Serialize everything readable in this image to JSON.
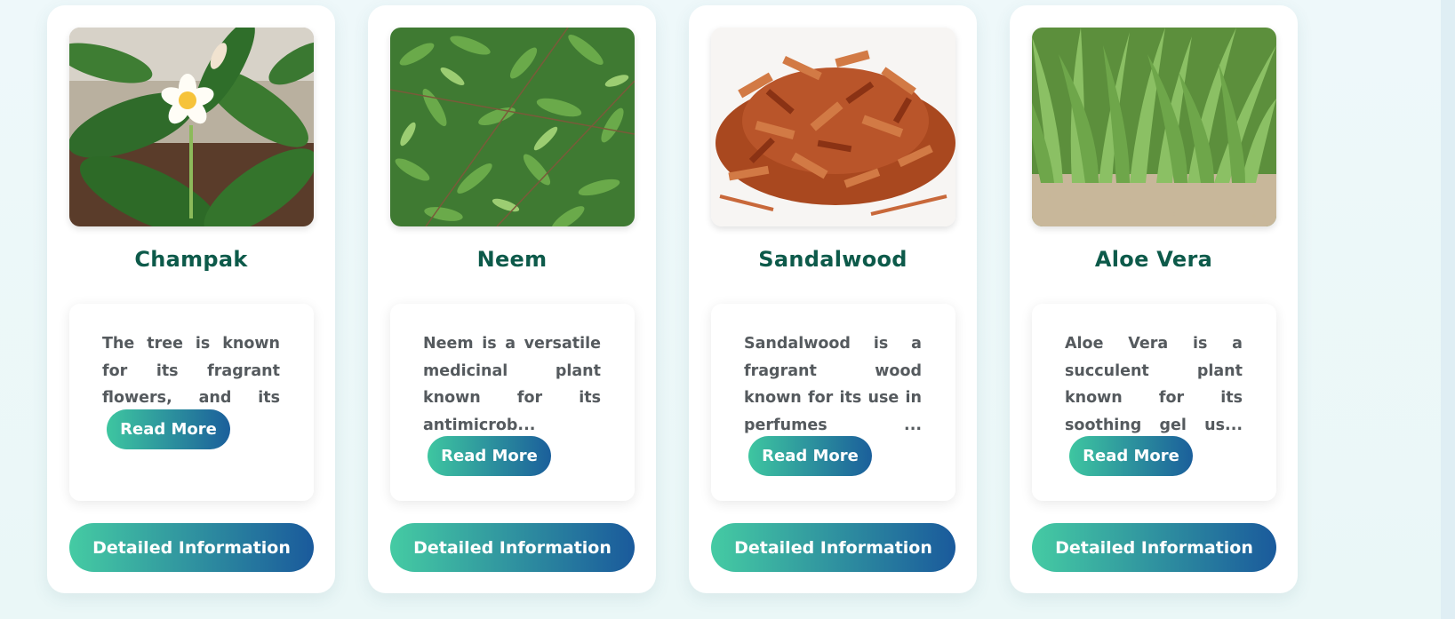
{
  "cards": [
    {
      "title": "Champak",
      "description": "The tree is known for its fragrant flowers, and its timber i...",
      "read_more_label": "Read More",
      "detail_label": "Detailed Information",
      "image_icon": "champak-flower-image"
    },
    {
      "title": "Neem",
      "description": "Neem is a versatile medicinal plant known for its antimicrob...",
      "read_more_label": "Read More",
      "detail_label": "Detailed Information",
      "image_icon": "neem-leaves-image"
    },
    {
      "title": "Sandalwood",
      "description": "Sandalwood is a fragrant wood known for its use in perfumes ...",
      "read_more_label": "Read More",
      "detail_label": "Detailed Information",
      "image_icon": "sandalwood-chips-image"
    },
    {
      "title": "Aloe Vera",
      "description": "Aloe Vera is a succulent plant known for its soothing gel us...",
      "read_more_label": "Read More",
      "detail_label": "Detailed Information",
      "image_icon": "aloe-vera-image"
    }
  ],
  "colors": {
    "title": "#0d5a4a",
    "button_gradient_start": "#45cba3",
    "button_gradient_end": "#1a5a9c",
    "page_background": "#eef8fa"
  }
}
